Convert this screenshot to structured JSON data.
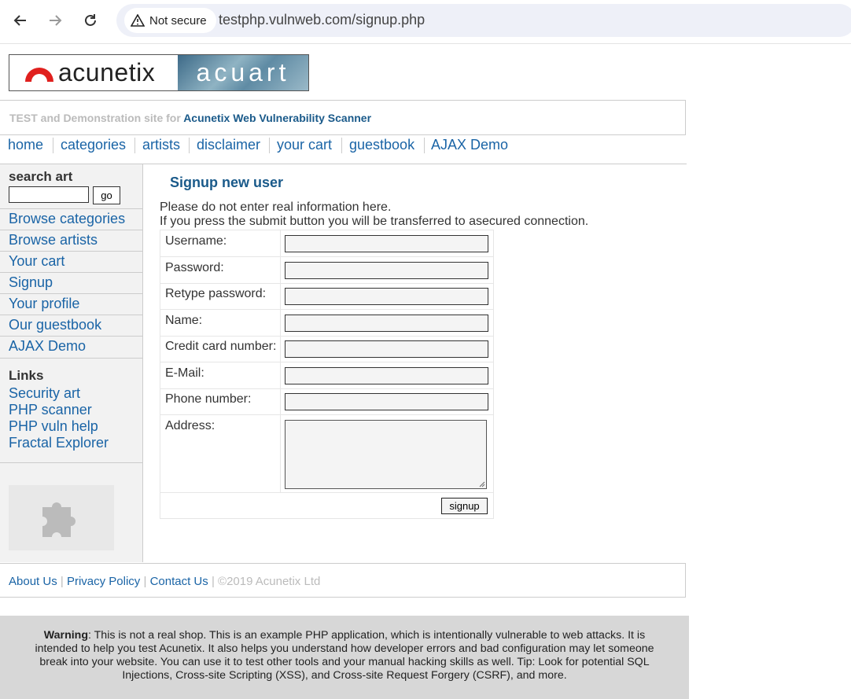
{
  "browser": {
    "security_label": "Not secure",
    "url": "testphp.vulnweb.com/signup.php"
  },
  "logo": {
    "left_text": "acunetix",
    "right_text": "acuart"
  },
  "tagline": {
    "prefix": "TEST and Demonstration site for",
    "brand": "Acunetix Web Vulnerability Scanner"
  },
  "topnav": [
    "home",
    "categories",
    "artists",
    "disclaimer",
    "your cart",
    "guestbook",
    "AJAX Demo"
  ],
  "sidebar": {
    "search_title": "search art",
    "search_button": "go",
    "items": [
      "Browse categories",
      "Browse artists",
      "Your cart",
      "Signup",
      "Your profile",
      "Our guestbook",
      "AJAX Demo"
    ],
    "links_title": "Links",
    "links": [
      "Security art",
      "PHP scanner",
      "PHP vuln help",
      "Fractal Explorer"
    ]
  },
  "main": {
    "title": "Signup new user",
    "note1": "Please do not enter real information here.",
    "note2": "If you press the submit button you will be transferred to asecured connection.",
    "fields": [
      "Username:",
      "Password:",
      "Retype password:",
      "Name:",
      "Credit card number:",
      "E-Mail:",
      "Phone number:",
      "Address:"
    ],
    "submit": "signup"
  },
  "footer": {
    "links": [
      "About Us",
      "Privacy Policy",
      "Contact Us"
    ],
    "copyright": "©2019 Acunetix Ltd"
  },
  "warning": {
    "label": "Warning",
    "text": ": This is not a real shop. This is an example PHP application, which is intentionally vulnerable to web attacks. It is intended to help you test Acunetix. It also helps you understand how developer errors and bad configuration may let someone break into your website. You can use it to test other tools and your manual hacking skills as well. Tip: Look for potential SQL Injections, Cross-site Scripting (XSS), and Cross-site Request Forgery (CSRF), and more."
  }
}
